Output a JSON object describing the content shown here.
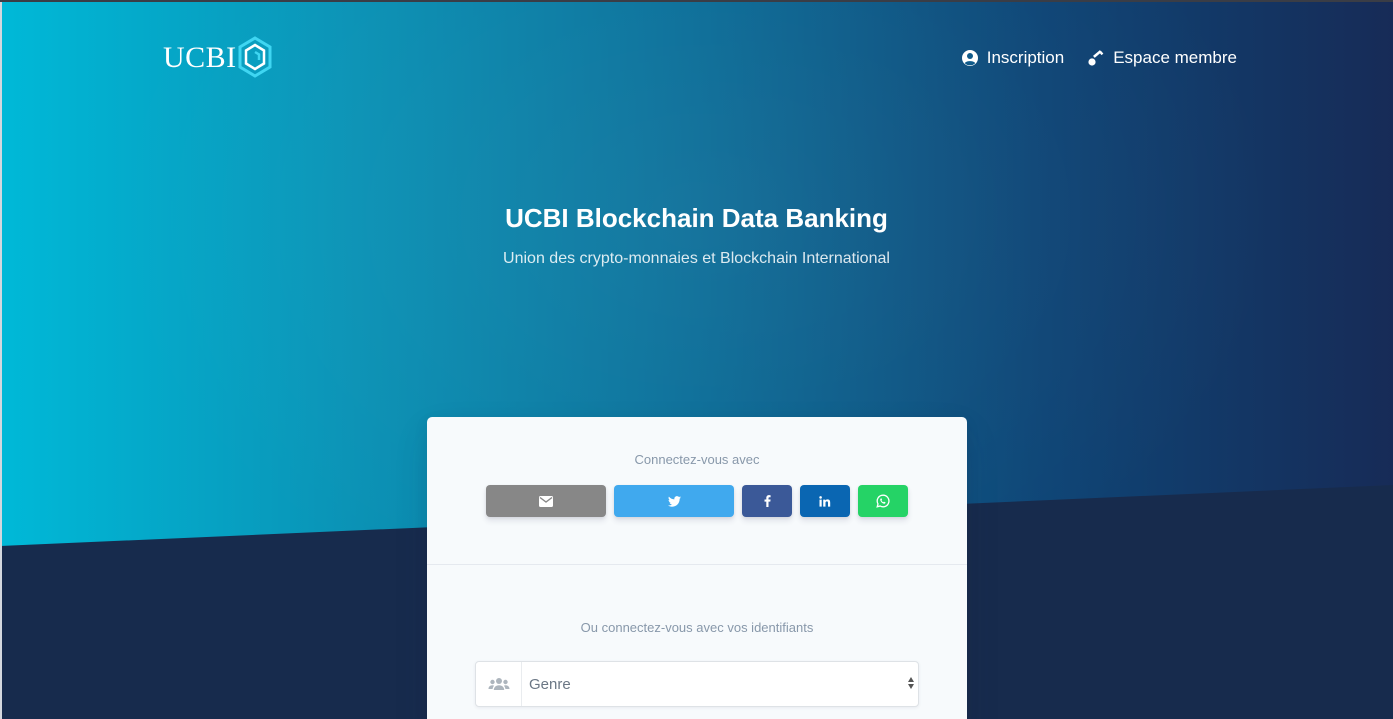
{
  "navbar": {
    "logo_text": "UCBI",
    "links": [
      {
        "label": "Inscription",
        "icon": "user-circle-icon"
      },
      {
        "label": "Espace membre",
        "icon": "key-icon"
      }
    ]
  },
  "hero": {
    "title": "UCBI Blockchain Data Banking",
    "subtitle": "Union des crypto-monnaies et Blockchain International"
  },
  "login_card": {
    "social_label": "Connectez-vous avec",
    "social_buttons": [
      {
        "name": "email",
        "icon": "envelope-icon",
        "color": "#878787"
      },
      {
        "name": "twitter",
        "icon": "twitter-icon",
        "color": "#40a9ee"
      },
      {
        "name": "facebook",
        "icon": "facebook-icon",
        "color": "#3b5998"
      },
      {
        "name": "linkedin",
        "icon": "linkedin-icon",
        "color": "#0a66b2"
      },
      {
        "name": "whatsapp",
        "icon": "whatsapp-icon",
        "color": "#25d366"
      }
    ],
    "credentials_label": "Ou connectez-vous avec vos identifiants",
    "genre_select": {
      "icon": "users-icon",
      "selected": "Genre"
    }
  },
  "colors": {
    "gradient_start": "#00b9d8",
    "gradient_end": "#172b57",
    "dark_navy": "#172b4d",
    "card_background": "#f7fafc"
  }
}
